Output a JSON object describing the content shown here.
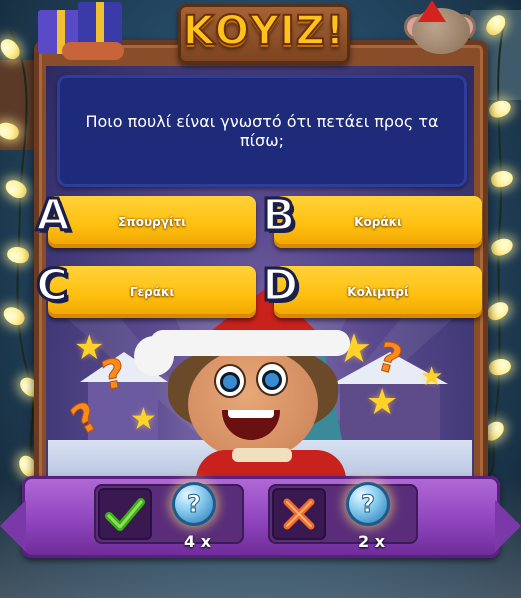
{
  "header": {
    "title": "ΚΟΥΙΖ!"
  },
  "question": {
    "text": "Ποιο πουλί είναι γνωστό ότι πετάει προς τα πίσω;"
  },
  "answers": [
    {
      "letter": "A",
      "label": "Σπουργίτι"
    },
    {
      "letter": "B",
      "label": "Κοράκι"
    },
    {
      "letter": "C",
      "label": "Γεράκι"
    },
    {
      "letter": "D",
      "label": "Κολιμπρί"
    }
  ],
  "stats": {
    "correct": {
      "icon": "check-icon",
      "count": "4 x"
    },
    "wrong": {
      "icon": "cross-icon",
      "count": "2 x"
    }
  },
  "coin_symbol": "?",
  "colors": {
    "answer_yellow": "#ffc010",
    "question_blue": "#1e2a7a",
    "title_gold": "#ffc21a",
    "bottom_purple": "#8f45bd",
    "check_green": "#3cb018",
    "cross_orange": "#f06a2a"
  }
}
